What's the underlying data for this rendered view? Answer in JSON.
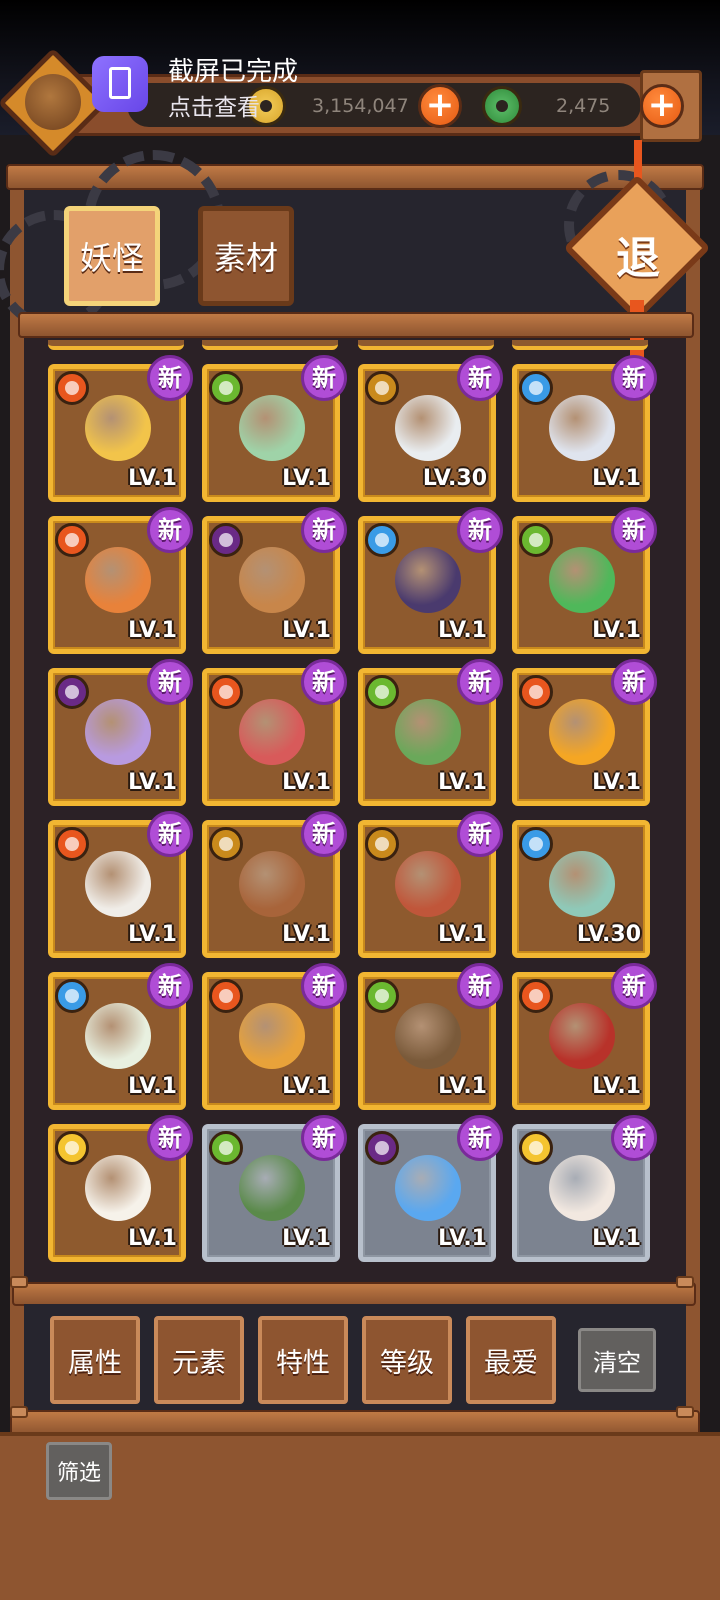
{
  "notification": {
    "title": "截屏已完成",
    "subtitle": "点击查看"
  },
  "currency": {
    "coins": "3,154,047",
    "jade": "2,475",
    "coin_color": "#d9a52a",
    "jade_color": "#2f8a3a"
  },
  "tabs": [
    {
      "label": "妖怪",
      "active": true
    },
    {
      "label": "素材",
      "active": false
    }
  ],
  "exit_button": {
    "label": "退"
  },
  "grid": [
    {
      "element": "fire",
      "level": "LV.1",
      "badge": "新",
      "frame": "gold"
    },
    {
      "element": "wood",
      "level": "LV.1",
      "badge": "新",
      "frame": "gold"
    },
    {
      "element": "earth",
      "level": "LV.30",
      "badge": "新",
      "frame": "gold"
    },
    {
      "element": "water",
      "level": "LV.1",
      "badge": "新",
      "frame": "gold"
    },
    {
      "element": "fire",
      "level": "LV.1",
      "badge": "新",
      "frame": "gold"
    },
    {
      "element": "dark",
      "level": "LV.1",
      "badge": "新",
      "frame": "gold"
    },
    {
      "element": "water",
      "level": "LV.1",
      "badge": "新",
      "frame": "gold"
    },
    {
      "element": "wood",
      "level": "LV.1",
      "badge": "新",
      "frame": "gold"
    },
    {
      "element": "dark",
      "level": "LV.1",
      "badge": "新",
      "frame": "gold"
    },
    {
      "element": "fire",
      "level": "LV.1",
      "badge": "新",
      "frame": "gold"
    },
    {
      "element": "wood",
      "level": "LV.1",
      "badge": "新",
      "frame": "gold"
    },
    {
      "element": "fire",
      "level": "LV.1",
      "badge": "新",
      "frame": "gold"
    },
    {
      "element": "fire",
      "level": "LV.1",
      "badge": "新",
      "frame": "gold"
    },
    {
      "element": "earth",
      "level": "LV.1",
      "badge": "新",
      "frame": "gold"
    },
    {
      "element": "earth",
      "level": "LV.1",
      "badge": "新",
      "frame": "gold"
    },
    {
      "element": "water",
      "level": "LV.30",
      "badge": "",
      "frame": "gold"
    },
    {
      "element": "water",
      "level": "LV.1",
      "badge": "新",
      "frame": "gold"
    },
    {
      "element": "fire",
      "level": "LV.1",
      "badge": "新",
      "frame": "gold"
    },
    {
      "element": "wood",
      "level": "LV.1",
      "badge": "新",
      "frame": "gold"
    },
    {
      "element": "fire",
      "level": "LV.1",
      "badge": "新",
      "frame": "gold"
    },
    {
      "element": "light",
      "level": "LV.1",
      "badge": "新",
      "frame": "gold"
    },
    {
      "element": "wood",
      "level": "LV.1",
      "badge": "新",
      "frame": "silver"
    },
    {
      "element": "dark",
      "level": "LV.1",
      "badge": "新",
      "frame": "silver"
    },
    {
      "element": "light",
      "level": "LV.1",
      "badge": "新",
      "frame": "silver"
    }
  ],
  "art_colors": [
    "#f2c44a",
    "#9fd3a8",
    "#e9edf0",
    "#dfe4ee",
    "#e8823a",
    "#c8864a",
    "#4a3a6e",
    "#4fb85a",
    "#b89ae0",
    "#d85a5a",
    "#6aa85a",
    "#f5a623",
    "#f0ede8",
    "#a8643a",
    "#c0563a",
    "#8fc9b8",
    "#e8f0e0",
    "#e8a23a",
    "#7a5a3a",
    "#b8322a",
    "#f6f2ea",
    "#5a8a4a",
    "#5aa8f0",
    "#f2e8e0"
  ],
  "filters": {
    "buttons": [
      "属性",
      "元素",
      "特性",
      "等级",
      "最爱"
    ],
    "clear": "清空",
    "screen": "筛选"
  }
}
